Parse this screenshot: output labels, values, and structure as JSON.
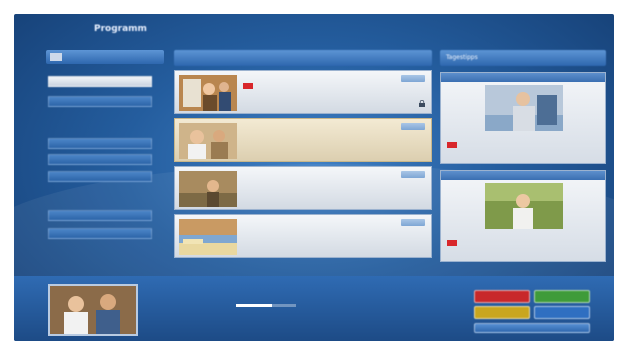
{
  "header": {
    "app_title": "Programm",
    "clock": ""
  },
  "sidebar": {
    "top_label": "",
    "items": [
      {
        "label": "",
        "active": true
      },
      {
        "label": "",
        "active": false
      },
      {
        "label": "",
        "active": false
      },
      {
        "label": "",
        "active": false
      },
      {
        "label": "",
        "active": false
      },
      {
        "label": "",
        "active": false
      },
      {
        "label": "",
        "active": false
      }
    ]
  },
  "program_list": {
    "header": "",
    "items": [
      {
        "line1": "",
        "line2": "",
        "line3": "",
        "recording": true,
        "selected": false,
        "locked": true
      },
      {
        "line1": "",
        "line2": "",
        "line3": "",
        "recording": false,
        "selected": true,
        "locked": false
      },
      {
        "line1": "",
        "line2": "",
        "line3": "",
        "recording": false,
        "selected": false,
        "locked": false
      },
      {
        "line1": "",
        "line2": "",
        "line3": "",
        "recording": false,
        "selected": false,
        "locked": false
      }
    ]
  },
  "tips": {
    "header": "Tagestipps",
    "cards": [
      {
        "channel": "",
        "time": "",
        "line1": "",
        "line2": ""
      },
      {
        "channel": "",
        "time": "",
        "line1": "",
        "line2": ""
      }
    ]
  },
  "now_playing": {
    "line1": "",
    "time": "",
    "title": "",
    "progress": 0.6
  },
  "buttons": {
    "red": "",
    "green": "",
    "yellow": "",
    "blue": "",
    "wide": ""
  },
  "colors": {
    "red": "#c8282a",
    "green": "#3f9b3a",
    "yellow": "#c9a61f",
    "blue": "#2f6fc1",
    "accent": "#2e67ae"
  }
}
